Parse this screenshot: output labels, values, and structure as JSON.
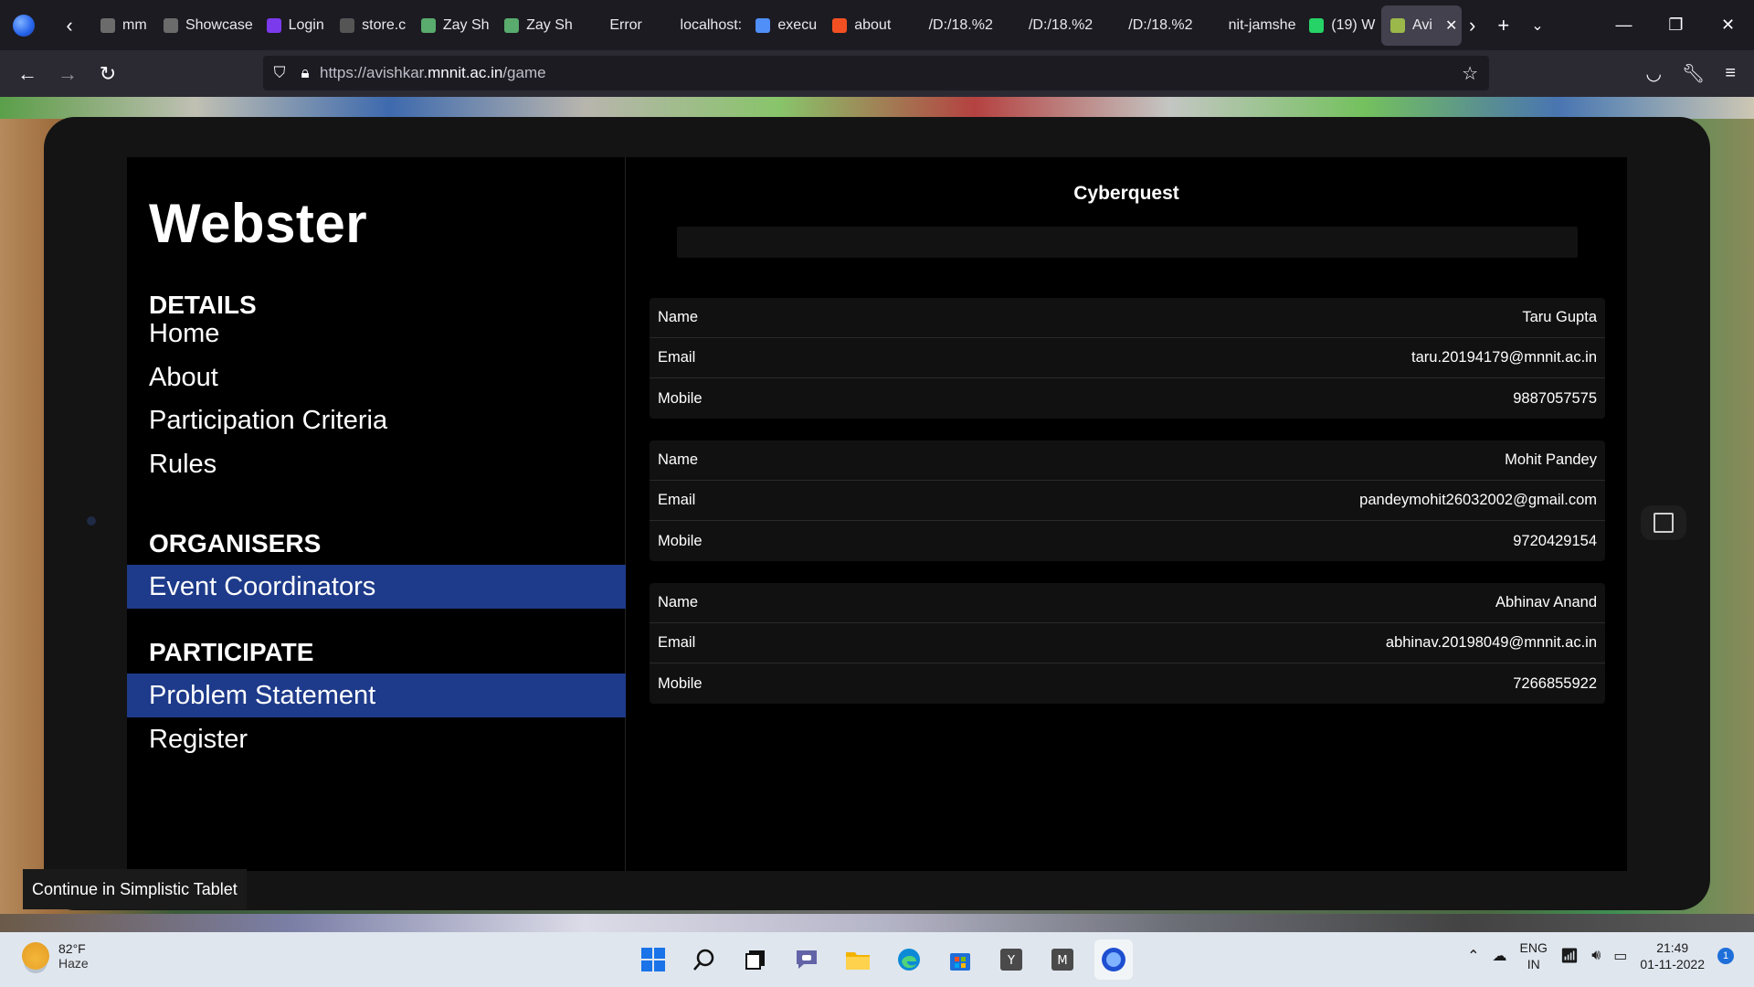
{
  "browser": {
    "tabs": [
      {
        "label": "mm",
        "icon": "page-icon",
        "color": "#6b6b6b"
      },
      {
        "label": "Showcase",
        "icon": "page-icon",
        "color": "#6b6b6b"
      },
      {
        "label": "Login",
        "icon": "login-app-icon",
        "color": "#7c3aed"
      },
      {
        "label": "store.c",
        "icon": "epic-icon",
        "color": "#555555"
      },
      {
        "label": "Zay Sh",
        "icon": "zay-icon",
        "color": "#59ab6e"
      },
      {
        "label": "Zay Sh",
        "icon": "zay-icon",
        "color": "#59ab6e"
      },
      {
        "label": "Error",
        "icon": "page-icon",
        "color": "#1c1b22"
      },
      {
        "label": "localhost:",
        "icon": "page-icon",
        "color": "#1c1b22"
      },
      {
        "label": "execu",
        "icon": "search-icon",
        "color": "#4f8ff7"
      },
      {
        "label": "about",
        "icon": "microsoft-icon",
        "color": "#f25022"
      },
      {
        "label": "/D:/18.%2",
        "icon": "page-icon",
        "color": "#1c1b22"
      },
      {
        "label": "/D:/18.%2",
        "icon": "page-icon",
        "color": "#1c1b22"
      },
      {
        "label": "/D:/18.%2",
        "icon": "page-icon",
        "color": "#1c1b22"
      },
      {
        "label": "nit-jamshe",
        "icon": "page-icon",
        "color": "#1c1b22"
      },
      {
        "label": "(19) W",
        "icon": "whatsapp-icon",
        "color": "#25d366"
      },
      {
        "label": "Avi",
        "icon": "avishkar-icon",
        "color": "#9ab94a",
        "active": true
      }
    ],
    "url_prefix": "https://avishkar.",
    "url_domain": "mnnit.ac.in",
    "url_path": "/game"
  },
  "tablet": {
    "brand": "Webster",
    "sections": {
      "details": "DETAILS",
      "organisers": "ORGANISERS",
      "participate": "PARTICIPATE"
    },
    "nav": {
      "home": "Home",
      "about": "About",
      "criteria": "Participation Criteria",
      "rules": "Rules",
      "coordinators": "Event Coordinators",
      "problem": "Problem Statement",
      "register": "Register"
    },
    "event_title": "Cyberquest",
    "field_labels": {
      "name": "Name",
      "email": "Email",
      "mobile": "Mobile"
    },
    "coordinators": [
      {
        "name": "Taru Gupta",
        "email": "taru.20194179@mnnit.ac.in",
        "mobile": "9887057575"
      },
      {
        "name": "Mohit Pandey",
        "email": "pandeymohit26032002@gmail.com",
        "mobile": "9720429154"
      },
      {
        "name": "Abhinav Anand",
        "email": "abhinav.20198049@mnnit.ac.in",
        "mobile": "7266855922"
      }
    ],
    "toast": "Continue in Simplistic Tablet"
  },
  "taskbar": {
    "weather_temp": "82°F",
    "weather_desc": "Haze",
    "lang_top": "ENG",
    "lang_bottom": "IN",
    "time": "21:49",
    "date": "01-11-2022",
    "notification_count": "1"
  }
}
